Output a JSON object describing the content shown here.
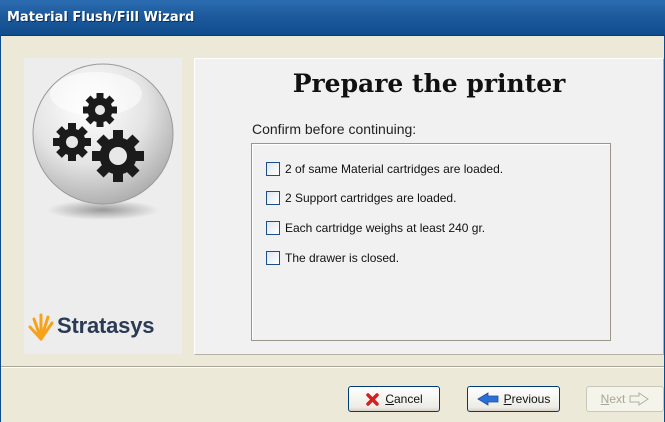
{
  "window": {
    "title": "Material Flush/Fill Wizard"
  },
  "branding": {
    "logo_text": "Stratasys",
    "logo_color": "#f7a21b",
    "icon": "gears-icon"
  },
  "content": {
    "heading": "Prepare the printer",
    "subtitle": "Confirm before continuing:",
    "checklist": [
      {
        "label": "2 of same Material cartridges are loaded.",
        "checked": false
      },
      {
        "label": "2 Support cartridges are loaded.",
        "checked": false
      },
      {
        "label": "Each cartridge weighs at least 240 gr.",
        "checked": false
      },
      {
        "label": "The drawer is closed.",
        "checked": false
      }
    ]
  },
  "buttons": {
    "cancel": {
      "label": "Cancel",
      "mnemonic": "C",
      "rest": "ancel",
      "icon": "red-x-icon",
      "enabled": true
    },
    "previous": {
      "label": "Previous",
      "mnemonic": "P",
      "rest": "revious",
      "icon": "back-arrow-icon",
      "enabled": true
    },
    "next": {
      "label": "Next",
      "mnemonic": "N",
      "rest": "ext",
      "icon": "forward-arrow-icon",
      "enabled": false
    }
  },
  "colors": {
    "titlebar": "#1f5c9f",
    "background": "#ece9d8",
    "cancel_icon": "#d52020",
    "previous_icon": "#2c6fd6"
  }
}
